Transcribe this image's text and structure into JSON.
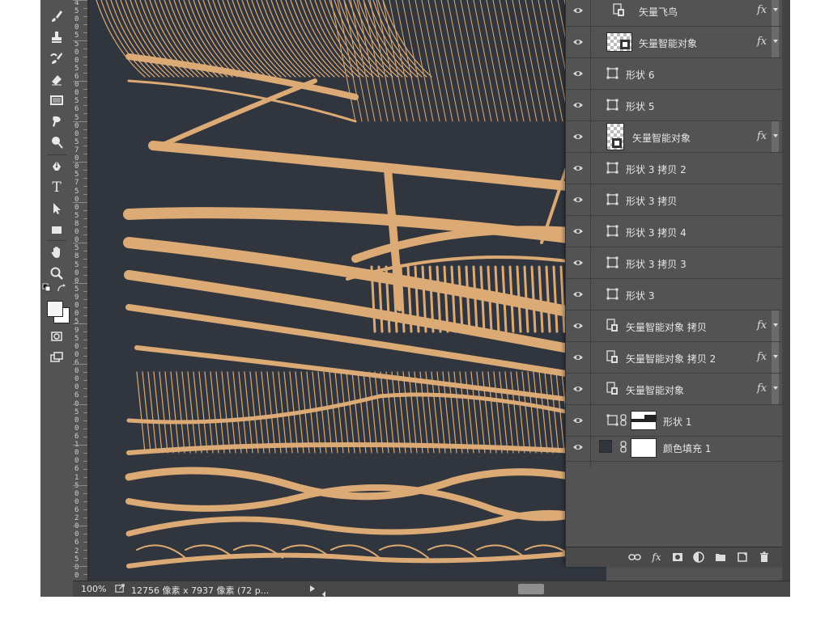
{
  "colors": {
    "canvas_bg": "#31353e",
    "artwork": "#dcaa75",
    "panel": "#535353"
  },
  "tools": [
    {
      "name": "brush-tool",
      "icon": "brush-icon"
    },
    {
      "name": "stamp-tool",
      "icon": "stamp-icon"
    },
    {
      "name": "history-brush-tool",
      "icon": "history-brush-icon"
    },
    {
      "name": "eraser-tool",
      "icon": "eraser-icon"
    },
    {
      "name": "gradient-tool",
      "icon": "gradient-icon"
    },
    {
      "name": "smudge-tool",
      "icon": "smudge-icon"
    },
    {
      "name": "dodge-tool",
      "icon": "dodge-icon"
    },
    {
      "name": "pen-tool",
      "icon": "pen-icon"
    },
    {
      "name": "type-tool",
      "icon": "type-icon",
      "label": "T"
    },
    {
      "name": "path-select-tool",
      "icon": "arrow-icon"
    },
    {
      "name": "rectangle-tool",
      "icon": "rectangle-icon"
    },
    {
      "name": "hand-tool",
      "icon": "hand-icon"
    },
    {
      "name": "zoom-tool",
      "icon": "zoom-icon"
    }
  ],
  "ruler": {
    "labels": [
      "4",
      "5",
      "0",
      "0",
      "5",
      "5",
      "0",
      "0",
      "5",
      "6",
      "0",
      "0",
      "5",
      "6",
      "5",
      "0",
      "0",
      "5",
      "7",
      "0",
      "0",
      "5",
      "7",
      "5",
      "0",
      "0",
      "5",
      "8",
      "0",
      "0",
      "5",
      "8",
      "5",
      "0",
      "0",
      "5",
      "9",
      "0",
      "0",
      "5",
      "9",
      "5",
      "0",
      "0",
      "6",
      "0",
      "0",
      "0",
      "6",
      "0",
      "5",
      "0",
      "0",
      "6",
      "1",
      "0",
      "0",
      "6",
      "1",
      "5",
      "0",
      "0",
      "6",
      "2",
      "0",
      "0",
      "6",
      "2",
      "5",
      "0",
      "0"
    ]
  },
  "layers": [
    {
      "name": "矢量飞鸟",
      "type": "smart",
      "fx": true
    },
    {
      "name": "矢量智能对象",
      "type": "smart-thumb",
      "fx": true
    },
    {
      "name": "形状 6",
      "type": "shape",
      "fx": false
    },
    {
      "name": "形状 5",
      "type": "shape",
      "fx": false
    },
    {
      "name": "矢量智能对象",
      "type": "smart-thumb-tall",
      "fx": true
    },
    {
      "name": "形状 3 拷贝 2",
      "type": "shape",
      "fx": false
    },
    {
      "name": "形状 3 拷贝",
      "type": "shape",
      "fx": false
    },
    {
      "name": "形状 3 拷贝 4",
      "type": "shape",
      "fx": false
    },
    {
      "name": "形状 3 拷贝 3",
      "type": "shape",
      "fx": false
    },
    {
      "name": "形状 3",
      "type": "shape",
      "fx": false
    },
    {
      "name": "矢量智能对象 拷贝",
      "type": "smart",
      "fx": true
    },
    {
      "name": "矢量智能对象 拷贝 2",
      "type": "smart",
      "fx": true
    },
    {
      "name": "矢量智能对象",
      "type": "smart",
      "fx": true
    },
    {
      "name": "形状 1",
      "type": "shape-mask",
      "fx": false
    },
    {
      "name": "颜色填充 1",
      "type": "fill",
      "fx": false
    }
  ],
  "footer_buttons": [
    "link-icon",
    "fx-icon",
    "mask-icon",
    "adjustment-icon",
    "folder-icon",
    "new-layer-icon",
    "trash-icon"
  ],
  "status": {
    "zoom": "100%",
    "doc_info": "12756 像素 x 7937 像素 (72 p..."
  }
}
